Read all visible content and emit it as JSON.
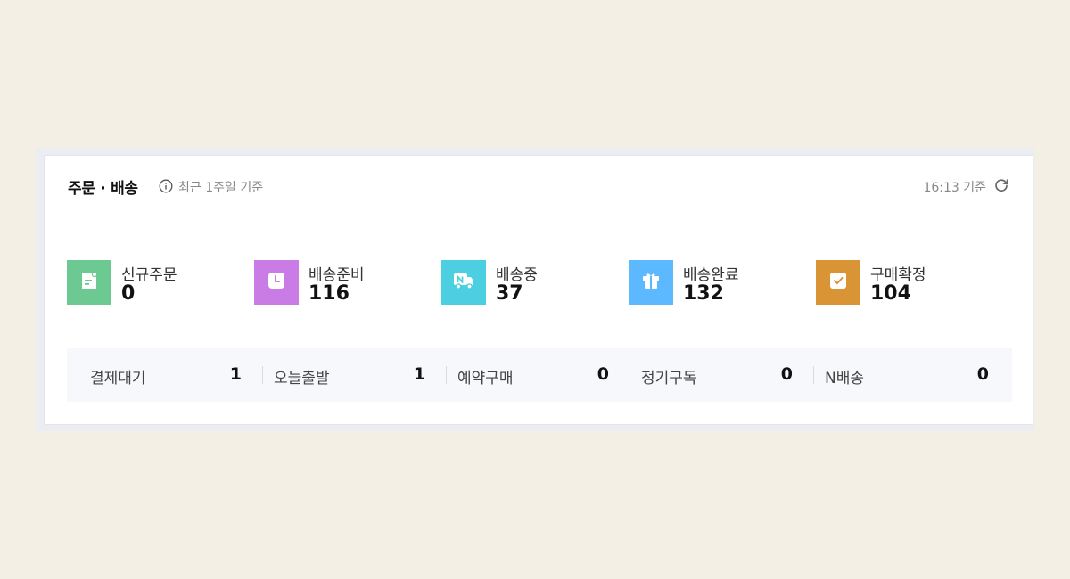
{
  "header": {
    "title": "주문 · 배송",
    "subtitle": "최근 1주일 기준",
    "updated": "16:13 기준"
  },
  "stats": [
    {
      "label": "신규주문",
      "value": "0",
      "icon": "new-order-icon",
      "color": "#6cc992"
    },
    {
      "label": "배송준비",
      "value": "116",
      "icon": "clock-icon",
      "color": "#c97be6"
    },
    {
      "label": "배송중",
      "value": "37",
      "icon": "truck-icon",
      "color": "#4ccfe0"
    },
    {
      "label": "배송완료",
      "value": "132",
      "icon": "gift-icon",
      "color": "#5cb8ff"
    },
    {
      "label": "구매확정",
      "value": "104",
      "icon": "check-icon",
      "color": "#d99436"
    }
  ],
  "sub": [
    {
      "label": "결제대기",
      "value": "1"
    },
    {
      "label": "오늘출발",
      "value": "1"
    },
    {
      "label": "예약구매",
      "value": "0"
    },
    {
      "label": "정기구독",
      "value": "0"
    },
    {
      "label": "N배송",
      "value": "0"
    }
  ]
}
